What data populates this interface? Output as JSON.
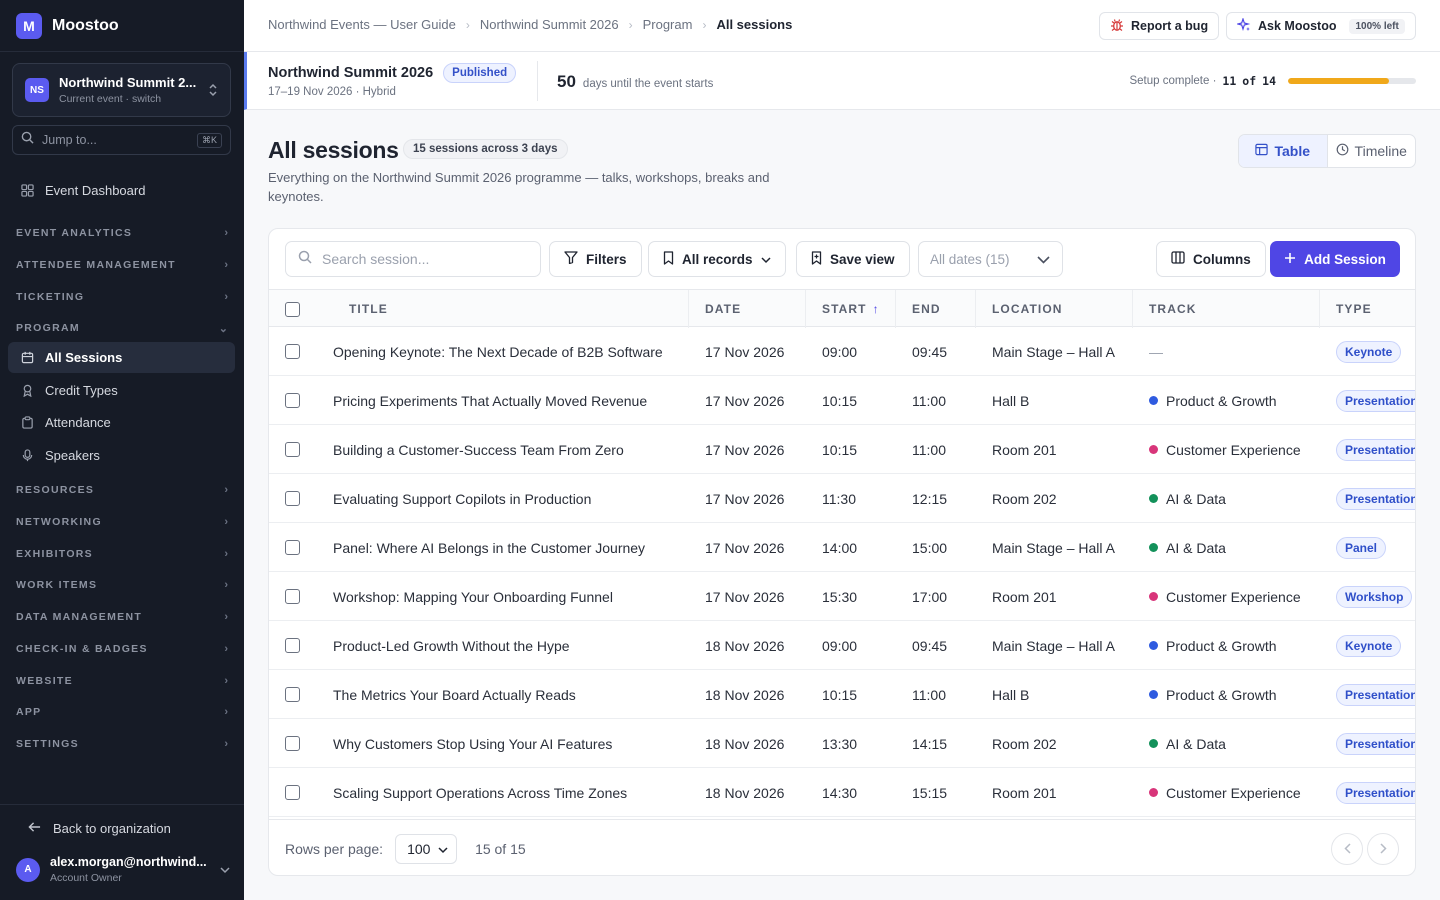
{
  "brand": {
    "logo_letter": "M",
    "name": "Moostoo"
  },
  "event_switcher": {
    "avatar": "NS",
    "name": "Northwind Summit 2...",
    "subtitle": "Current event · switch"
  },
  "jump": {
    "placeholder": "Jump to...",
    "shortcut": "⌘K"
  },
  "sidebar": {
    "dashboard": "Event Dashboard",
    "sections": {
      "event_analytics": "EVENT ANALYTICS",
      "attendee_management": "ATTENDEE MANAGEMENT",
      "ticketing": "TICKETING",
      "program": "PROGRAM",
      "resources": "RESOURCES",
      "networking": "NETWORKING",
      "exhibitors": "EXHIBITORS",
      "work_items": "WORK ITEMS",
      "data_management": "DATA MANAGEMENT",
      "checkin_badges": "CHECK-IN & BADGES",
      "website": "WEBSITE",
      "app": "APP",
      "settings": "SETTINGS"
    },
    "program_items": {
      "all_sessions": "All Sessions",
      "credit_types": "Credit Types",
      "attendance": "Attendance",
      "speakers": "Speakers"
    },
    "back_link": "Back to organization",
    "user": {
      "avatar": "A",
      "email": "alex.morgan@northwind...",
      "role": "Account Owner"
    }
  },
  "breadcrumbs": [
    "Northwind Events — User Guide",
    "Northwind Summit 2026",
    "Program",
    "All sessions"
  ],
  "topbar": {
    "report_bug": "Report a bug",
    "ask": "Ask Moostoo",
    "ask_quota": "100% left"
  },
  "event_strip": {
    "name": "Northwind Summit 2026",
    "status": "Published",
    "dates": "17–19 Nov 2026 · Hybrid",
    "days": "50",
    "days_label": "days until the event starts",
    "setup_label": "Setup complete ·",
    "setup_done": "11",
    "setup_of": "of",
    "setup_total": "14",
    "setup_fraction": 0.786
  },
  "page": {
    "title": "All sessions",
    "count": "15 sessions across 3 days",
    "description": "Everything on the Northwind Summit 2026 programme — talks, workshops, breaks and keynotes.",
    "view_table": "Table",
    "view_timeline": "Timeline"
  },
  "toolbar": {
    "search_placeholder": "Search session...",
    "filters": "Filters",
    "all_records": "All records",
    "save_view": "Save view",
    "dates": "All dates (15)",
    "columns": "Columns",
    "add": "Add Session"
  },
  "columns": [
    "TITLE",
    "DATE",
    "START",
    "END",
    "LOCATION",
    "TRACK",
    "TYPE"
  ],
  "sort_indicator": "↑",
  "track_colors": {
    "Product & Growth": "#2f5be0",
    "Customer Experience": "#d8357a",
    "AI & Data": "#13915a"
  },
  "rows": [
    {
      "title": "Opening Keynote: The Next Decade of B2B Software",
      "date": "17 Nov 2026",
      "start": "09:00",
      "end": "09:45",
      "location": "Main Stage – Hall A",
      "track": "—",
      "type": "Keynote"
    },
    {
      "title": "Pricing Experiments That Actually Moved Revenue",
      "date": "17 Nov 2026",
      "start": "10:15",
      "end": "11:00",
      "location": "Hall B",
      "track": "Product & Growth",
      "type": "Presentation"
    },
    {
      "title": "Building a Customer-Success Team From Zero",
      "date": "17 Nov 2026",
      "start": "10:15",
      "end": "11:00",
      "location": "Room 201",
      "track": "Customer Experience",
      "type": "Presentation"
    },
    {
      "title": "Evaluating Support Copilots in Production",
      "date": "17 Nov 2026",
      "start": "11:30",
      "end": "12:15",
      "location": "Room 202",
      "track": "AI & Data",
      "type": "Presentation"
    },
    {
      "title": "Panel: Where AI Belongs in the Customer Journey",
      "date": "17 Nov 2026",
      "start": "14:00",
      "end": "15:00",
      "location": "Main Stage – Hall A",
      "track": "AI & Data",
      "type": "Panel"
    },
    {
      "title": "Workshop: Mapping Your Onboarding Funnel",
      "date": "17 Nov 2026",
      "start": "15:30",
      "end": "17:00",
      "location": "Room 201",
      "track": "Customer Experience",
      "type": "Workshop"
    },
    {
      "title": "Product-Led Growth Without the Hype",
      "date": "18 Nov 2026",
      "start": "09:00",
      "end": "09:45",
      "location": "Main Stage – Hall A",
      "track": "Product & Growth",
      "type": "Keynote"
    },
    {
      "title": "The Metrics Your Board Actually Reads",
      "date": "18 Nov 2026",
      "start": "10:15",
      "end": "11:00",
      "location": "Hall B",
      "track": "Product & Growth",
      "type": "Presentation"
    },
    {
      "title": "Why Customers Stop Using Your AI Features",
      "date": "18 Nov 2026",
      "start": "13:30",
      "end": "14:15",
      "location": "Room 202",
      "track": "AI & Data",
      "type": "Presentation"
    },
    {
      "title": "Scaling Support Operations Across Time Zones",
      "date": "18 Nov 2026",
      "start": "14:30",
      "end": "15:15",
      "location": "Room 201",
      "track": "Customer Experience",
      "type": "Presentation"
    }
  ],
  "footer": {
    "rows_label": "Rows per page:",
    "rows_value": "100",
    "range": "15 of 15"
  }
}
